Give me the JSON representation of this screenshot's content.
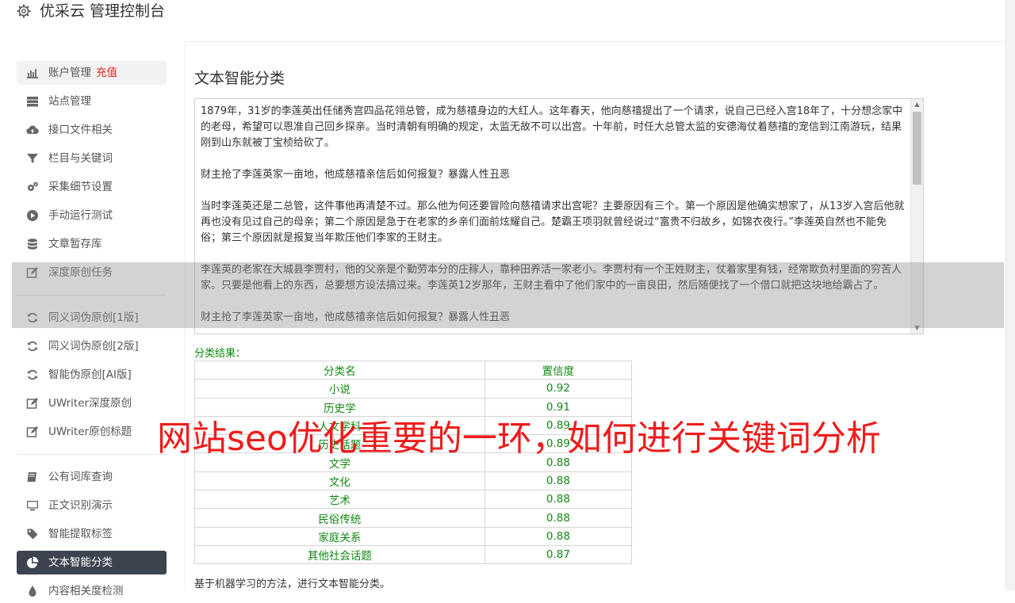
{
  "app": {
    "title": "优采云 管理控制台"
  },
  "sidebar": {
    "groups": [
      [
        {
          "label": "账户管理",
          "extra": "充值",
          "icon": "bar-chart-icon"
        },
        {
          "label": "站点管理",
          "icon": "server-icon"
        },
        {
          "label": "接口文件相关",
          "icon": "cloud-upload-icon"
        },
        {
          "label": "栏目与关键词",
          "icon": "filter-icon"
        },
        {
          "label": "采集细节设置",
          "icon": "cogs-icon"
        },
        {
          "label": "手动运行测试",
          "icon": "play-circle-icon"
        },
        {
          "label": "文章暂存库",
          "icon": "database-icon"
        },
        {
          "label": "深度原创任务",
          "icon": "edit-icon"
        }
      ],
      [
        {
          "label": "同义词伪原创[1版]",
          "icon": "refresh-icon"
        },
        {
          "label": "同义词伪原创[2版]",
          "icon": "refresh-icon"
        },
        {
          "label": "智能伪原创[AI版]",
          "icon": "refresh-icon"
        },
        {
          "label": "UWriter深度原创",
          "icon": "edit-icon"
        },
        {
          "label": "UWriter原创标题",
          "icon": "edit-icon"
        }
      ],
      [
        {
          "label": "公有词库查询",
          "icon": "book-icon"
        },
        {
          "label": "正文识别演示",
          "icon": "monitor-icon"
        },
        {
          "label": "智能提取标签",
          "icon": "tag-icon"
        },
        {
          "label": "文本智能分类",
          "icon": "pie-chart-icon"
        },
        {
          "label": "内容相关度检测",
          "icon": "tint-icon"
        }
      ]
    ]
  },
  "main": {
    "title": "文本智能分类",
    "textarea_paragraphs": [
      "1879年，31岁的李莲英出任储秀宫四品花翎总管，成为慈禧身边的大红人。这年春天，他向慈禧提出了一个请求，说自己已经入宫18年了，十分想念家中的老母，希望可以恩准自己回乡探亲。当时清朝有明确的规定，太监无故不可以出宫。十年前，时任大总管太监的安德海仗着慈禧的宠信到江南游玩，结果刚到山东就被丁宝桢给砍了。",
      "财主抢了李莲英家一亩地，他成慈禧亲信后如何报复？暴露人性丑恶",
      "当时李莲英还是二总管，这件事他再清楚不过。那么他为何还要冒险向慈禧请求出宫呢？主要原因有三个。第一个原因是他确实想家了，从13岁入宫后他就再也没有见过自己的母亲；第二个原因是急于在老家的乡亲们面前炫耀自己。楚霸王项羽就曾经说过“富贵不归故乡，如锦衣夜行。”李莲英自然也不能免俗；第三个原因就是报复当年欺压他们李家的王财主。",
      "李莲英的老家在大城县李贾村，他的父亲是个勤劳本分的庄稼人，靠种田养活一家老小。李贾村有一个王姓财主，仗着家里有钱，经常欺负村里面的穷苦人家。只要是他看上的东西，总要想方设法搞过来。李莲英12岁那年，王财主看中了他们家中的一亩良田，然后随便找了一个借口就把这块地给霸占了。",
      "财主抢了李莲英家一亩地，他成慈禧亲信后如何报复？暴露人性丑恶"
    ],
    "result_label": "分类结果：",
    "table": {
      "headers": [
        "分类名",
        "置信度"
      ],
      "rows": [
        [
          "小说",
          "0.92"
        ],
        [
          "历史学",
          "0.91"
        ],
        [
          "人文学科",
          "0.89"
        ],
        [
          "历史话题",
          "0.89"
        ],
        [
          "文学",
          "0.88"
        ],
        [
          "文化",
          "0.88"
        ],
        [
          "艺术",
          "0.88"
        ],
        [
          "民俗传统",
          "0.88"
        ],
        [
          "家庭关系",
          "0.88"
        ],
        [
          "其他社会话题",
          "0.87"
        ]
      ]
    },
    "method_note": "基于机器学习的方法，进行文本智能分类。"
  },
  "watermark": "网站seo优化重要的一环，如何进行关键词分析",
  "colors": {
    "accent_red": "#e02020",
    "result_green": "#118811",
    "active_bg": "#3d4450",
    "watermark": "#ee1c1c"
  }
}
